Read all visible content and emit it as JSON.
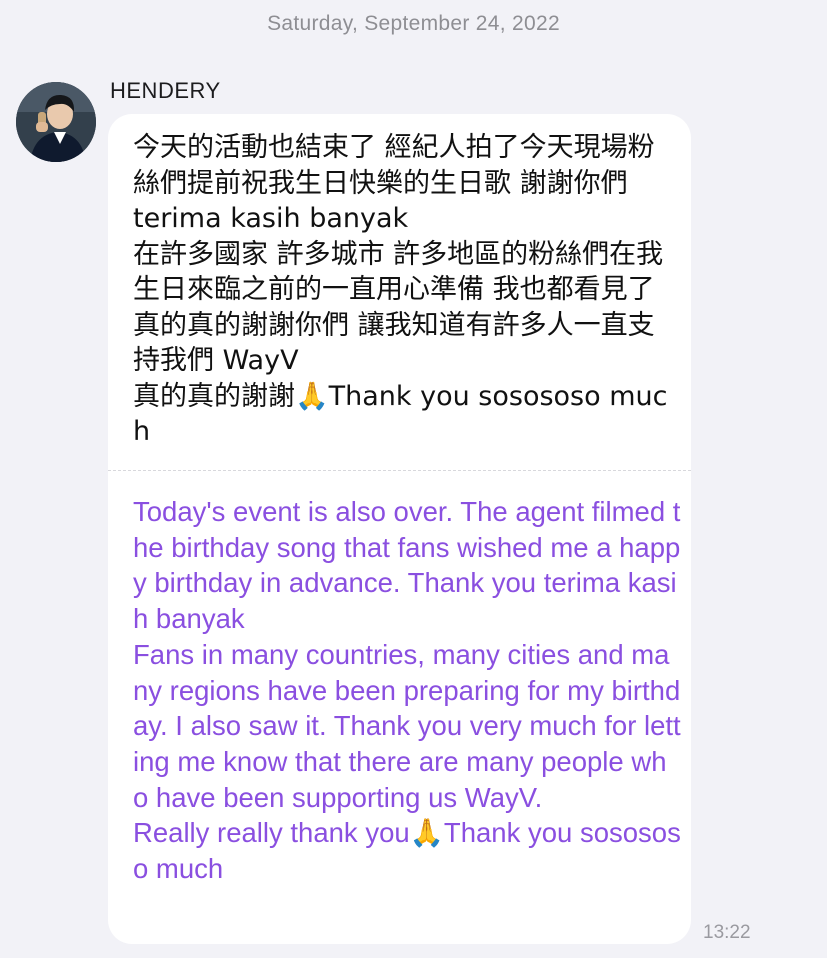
{
  "chat": {
    "date_header": "Saturday, September 24, 2022"
  },
  "message": {
    "sender": "HENDERY",
    "avatar_icon": "profile-photo-avatar",
    "original_text": "今天的活動也結束了 經紀人拍了今天現場粉絲們提前祝我生日快樂的生日歌 謝謝你們\nterima kasih banyak\n在許多國家 許多城市 許多地區的粉絲們在我生日來臨之前的一直用心準備 我也都看見了 真的真的謝謝你們 讓我知道有許多人一直支持我們 WayV\n真的真的謝謝🙏Thank you sosososo much",
    "translated_text": "Today's event is also over. The agent filmed the birthday song that fans wished me a happy birthday in advance. Thank you terima kasih banyak\nFans in many countries, many cities and many regions have been preparing for my birthday. I also saw it. Thank you very much for letting me know that there are many people who have been supporting us WayV.\nReally really thank you🙏Thank you sosososo much",
    "time": "13:22"
  },
  "colors": {
    "background": "#f2f2f7",
    "bubble": "#ffffff",
    "translation_text": "#8a4fe0",
    "meta_text": "#8e8e93"
  }
}
